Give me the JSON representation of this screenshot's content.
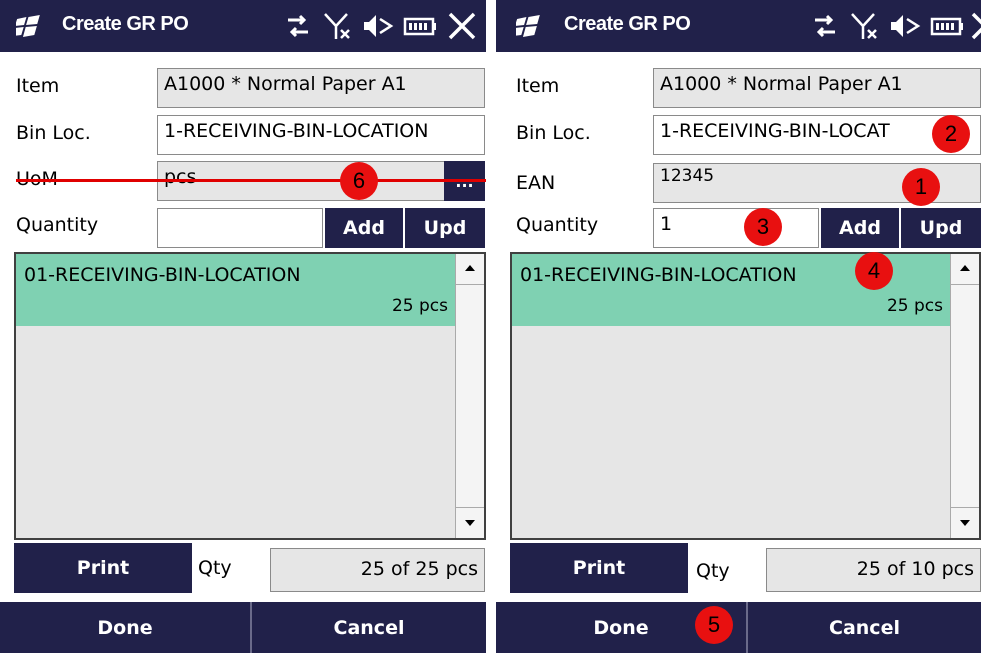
{
  "left": {
    "title": "Create GR PO",
    "item": {
      "label": "Item",
      "value": "A1000 * Normal Paper A1"
    },
    "bin": {
      "label": "Bin Loc.",
      "value": "1-RECEIVING-BIN-LOCATION"
    },
    "uom": {
      "label": "UoM",
      "value": "pcs",
      "browse_label": "..."
    },
    "quantity": {
      "label": "Quantity",
      "value": ""
    },
    "add_label": "Add",
    "upd_label": "Upd",
    "list": [
      {
        "name": "01-RECEIVING-BIN-LOCATION",
        "qty": "25 pcs"
      }
    ],
    "print_label": "Print",
    "qty_label": "Qty",
    "qty_value": "25 of 25 pcs",
    "done_label": "Done",
    "cancel_label": "Cancel",
    "markers": {
      "m6": "6"
    }
  },
  "right": {
    "title": "Create GR PO",
    "item": {
      "label": "Item",
      "value": "A1000 * Normal Paper A1"
    },
    "bin": {
      "label": "Bin Loc.",
      "value": "1-RECEIVING-BIN-LOCAT"
    },
    "ean": {
      "label": "EAN",
      "value": "12345"
    },
    "quantity": {
      "label": "Quantity",
      "value": "1"
    },
    "add_label": "Add",
    "upd_label": "Upd",
    "list": [
      {
        "name": "01-RECEIVING-BIN-LOCATION",
        "qty": "25 pcs"
      }
    ],
    "print_label": "Print",
    "qty_label": "Qty",
    "qty_value": "25 of 10 pcs",
    "done_label": "Done",
    "cancel_label": "Cancel",
    "markers": {
      "m1": "1",
      "m2": "2",
      "m3": "3",
      "m4": "4",
      "m5": "5"
    }
  },
  "colors": {
    "header": "#21214a",
    "row_highlight": "#7fd1b2",
    "marker": "#e81010",
    "field_readonly": "#e6e6e6"
  },
  "icons": [
    "windows-logo-icon",
    "connectivity-icon",
    "no-signal-icon",
    "volume-mute-icon",
    "battery-icon",
    "close-icon"
  ]
}
